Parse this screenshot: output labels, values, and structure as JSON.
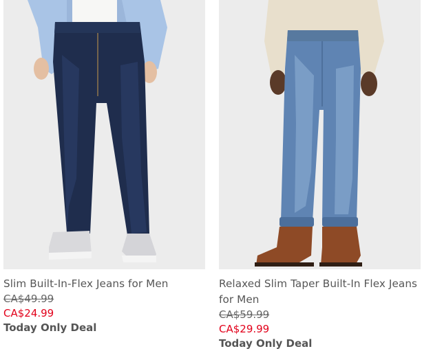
{
  "products": [
    {
      "name": "Slim Built-In-Flex Jeans for Men",
      "original_price": "CA$49.99",
      "sale_price": "CA$24.99",
      "deal_label": "Today Only Deal"
    },
    {
      "name": "Relaxed Slim Taper Built-In Flex Jeans for Men",
      "original_price": "CA$59.99",
      "sale_price": "CA$29.99",
      "deal_label": "Today Only Deal"
    }
  ],
  "colors": {
    "sale_price": "#e2001a",
    "text": "#555555",
    "image_background": "#ededed"
  }
}
